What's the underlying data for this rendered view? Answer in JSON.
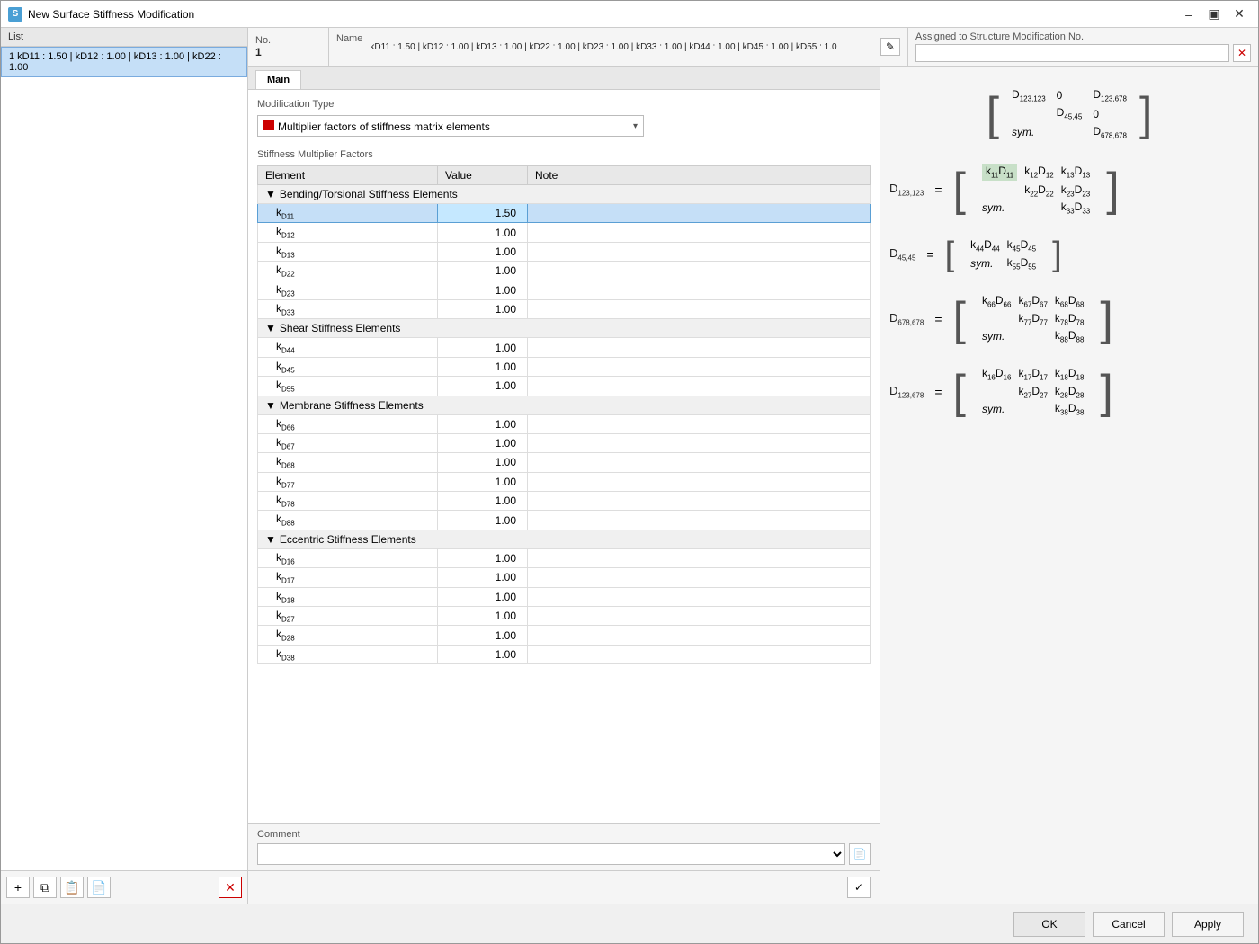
{
  "window": {
    "title": "New Surface Stiffness Modification",
    "icon": "S"
  },
  "left_panel": {
    "header": "List",
    "items": [
      {
        "label": "1  kD11 : 1.50 | kD12 : 1.00 | kD13 : 1.00 | kD22 : 1.00"
      }
    ]
  },
  "top_bar": {
    "no_label": "No.",
    "no_value": "1",
    "name_label": "Name",
    "name_value": "kD11 : 1.50 | kD12 : 1.00 | kD13 : 1.00 | kD22 : 1.00 | kD23 : 1.00 | kD33 : 1.00 | kD44 : 1.00 | kD45 : 1.00 | kD55 : 1.0",
    "assigned_label": "Assigned to Structure Modification No.",
    "assigned_value": ""
  },
  "tab": "Main",
  "modification_type": {
    "label": "Modification Type",
    "value": "Multiplier factors of stiffness matrix elements"
  },
  "stiffness": {
    "header": "Stiffness Multiplier Factors",
    "col_element": "Element",
    "col_value": "Value",
    "col_note": "Note",
    "groups": [
      {
        "name": "Bending/Torsional Stiffness Elements",
        "rows": [
          {
            "element": "kD11",
            "value": "1.50",
            "selected": true,
            "editing": true
          },
          {
            "element": "kD12",
            "value": "1.00"
          },
          {
            "element": "kD13",
            "value": "1.00"
          },
          {
            "element": "kD22",
            "value": "1.00"
          },
          {
            "element": "kD23",
            "value": "1.00"
          },
          {
            "element": "kD33",
            "value": "1.00"
          }
        ]
      },
      {
        "name": "Shear Stiffness Elements",
        "rows": [
          {
            "element": "kD44",
            "value": "1.00"
          },
          {
            "element": "kD45",
            "value": "1.00"
          },
          {
            "element": "kD55",
            "value": "1.00"
          }
        ]
      },
      {
        "name": "Membrane Stiffness Elements",
        "rows": [
          {
            "element": "kD66",
            "value": "1.00"
          },
          {
            "element": "kD67",
            "value": "1.00"
          },
          {
            "element": "kD68",
            "value": "1.00"
          },
          {
            "element": "kD77",
            "value": "1.00"
          },
          {
            "element": "kD78",
            "value": "1.00"
          },
          {
            "element": "kD88",
            "value": "1.00"
          }
        ]
      },
      {
        "name": "Eccentric Stiffness Elements",
        "rows": [
          {
            "element": "kD16",
            "value": "1.00"
          },
          {
            "element": "kD17",
            "value": "1.00"
          },
          {
            "element": "kD18",
            "value": "1.00"
          },
          {
            "element": "kD27",
            "value": "1.00"
          },
          {
            "element": "kD28",
            "value": "1.00"
          },
          {
            "element": "kD38",
            "value": "1.00"
          }
        ]
      }
    ]
  },
  "comment": {
    "label": "Comment",
    "value": "",
    "placeholder": ""
  },
  "buttons": {
    "ok": "OK",
    "cancel": "Cancel",
    "apply": "Apply"
  },
  "math": {
    "top_matrix": {
      "lhs": "",
      "cells": [
        "D₁₂₃,₁₂₃",
        "0",
        "D₁₂₃,₆₇₈",
        "",
        "D₄₅,₄₅",
        "0",
        "sym.",
        "",
        "D₆₇₈,₆₇₈"
      ]
    },
    "d123_matrix": {
      "lhs": "D₁₂₃,₁₂₃",
      "cells": [
        "k₁₁D₁₁",
        "k₁₂D₁₂",
        "k₁₃D₁₃",
        "",
        "k₂₂D₂₂",
        "k₂₃D₂₃",
        "sym.",
        "",
        "k₃₃D₃₃"
      ],
      "highlighted_cells": [
        0
      ]
    },
    "d4545_matrix": {
      "lhs": "D₄₅,₄₅",
      "cells": [
        "k₄₄D₄₄",
        "k₄₅D₄₅",
        "sym.",
        "k₅₅D₅₅"
      ]
    },
    "d678_matrix": {
      "lhs": "D₆₇₈,₆₇₈",
      "cells": [
        "k₆₆D₆₆",
        "k₆₇D₆₇",
        "k₆₈D₆₈",
        "",
        "k₇₇D₇₇",
        "k₇₈D₇₈",
        "sym.",
        "",
        "k₈₈D₈₈"
      ]
    },
    "d123678_matrix": {
      "lhs": "D₁₂₃,₆₇₈",
      "cells": [
        "k₁₆D₁₆",
        "k₁₇D₁₇",
        "k₁₈D₁₈",
        "",
        "k₂₇D₂₇",
        "k₂₈D₂₈",
        "sym.",
        "",
        "k₃₈D₃₈"
      ]
    }
  }
}
